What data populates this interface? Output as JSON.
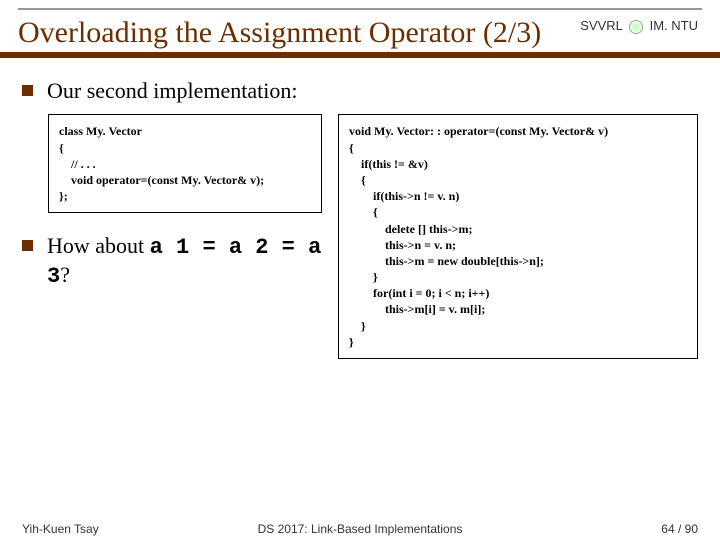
{
  "brand": {
    "left": "SVVRL",
    "right": "IM. NTU"
  },
  "title": "Overloading the Assignment Operator (2/3)",
  "bullets": {
    "first": "Our second implementation:",
    "second_prefix": "How about ",
    "second_code": "a 1 = a 2 = a 3",
    "second_suffix": "?"
  },
  "code_left": "class My. Vector\n{\n    // . . .\n    void operator=(const My. Vector& v);\n};",
  "code_right": "void My. Vector: : operator=(const My. Vector& v)\n{\n    if(this != &v)\n    {\n        if(this->n != v. n)\n        {\n            delete [] this->m;\n            this->n = v. n;\n            this->m = new double[this->n];\n        }\n        for(int i = 0; i < n; i++)\n            this->m[i] = v. m[i];\n    }\n}",
  "footer": {
    "left": "Yih-Kuen Tsay",
    "center": "DS 2017: Link-Based Implementations",
    "right": "64 / 90"
  }
}
